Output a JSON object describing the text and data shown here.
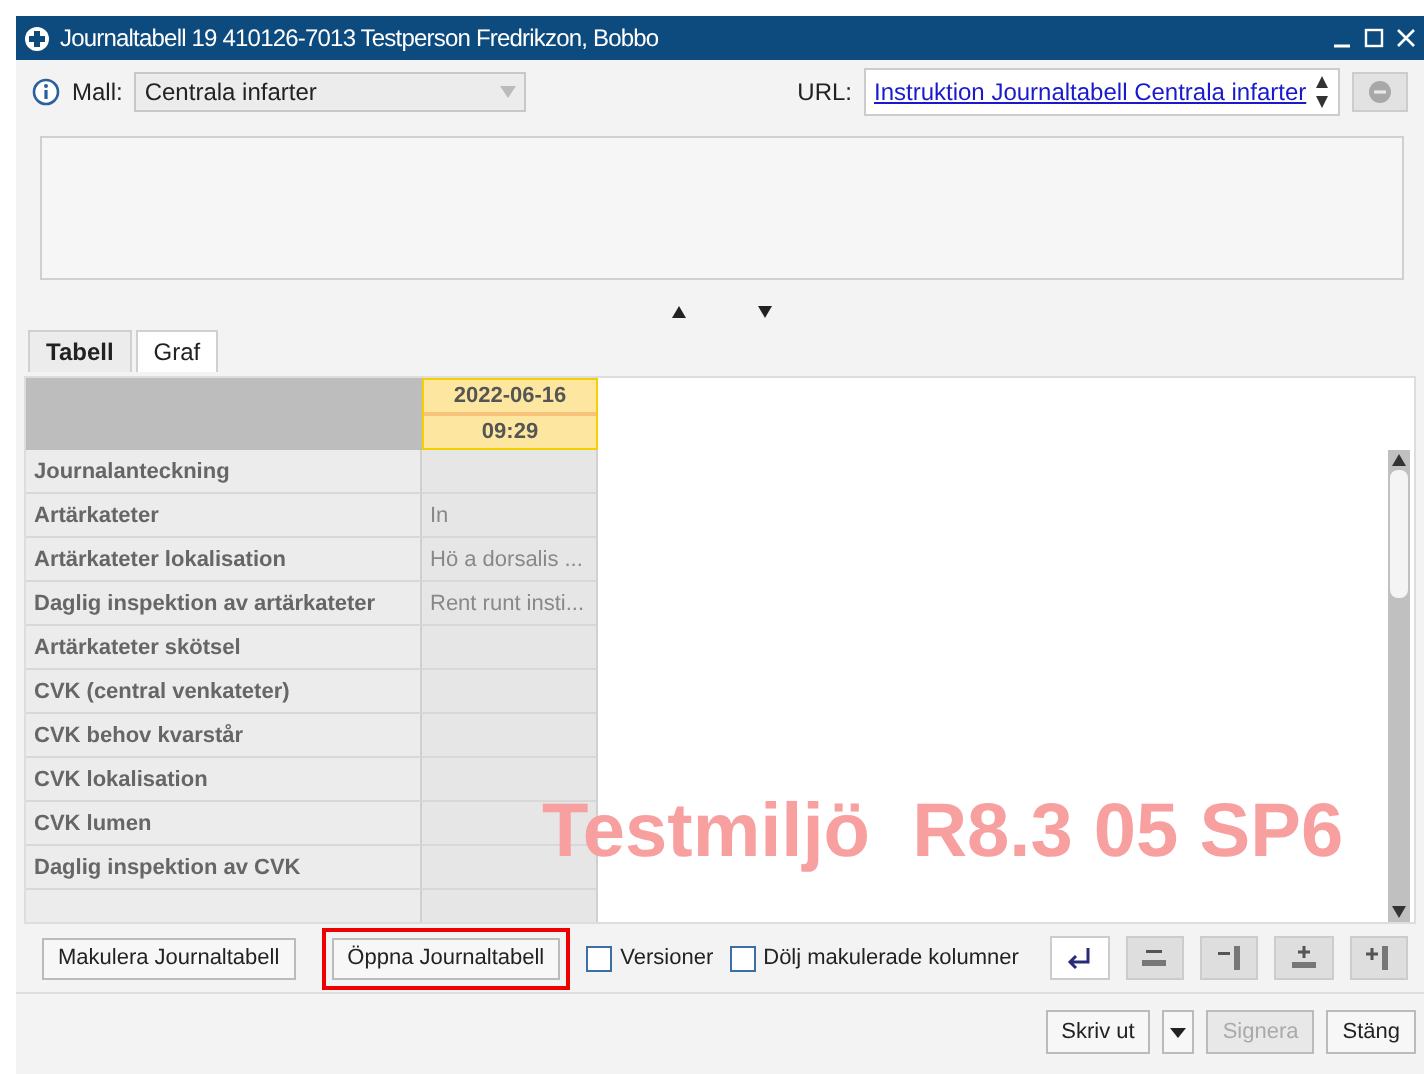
{
  "window": {
    "title": "Journaltabell 19 410126-7013 Testperson Fredrikzon, Bobbo"
  },
  "template": {
    "label": "Mall:",
    "value": "Centrala infarter"
  },
  "url": {
    "label": "URL:",
    "link": "Instruktion Journaltabell Centrala infarter"
  },
  "tabs": [
    {
      "label": "Tabell",
      "selected": true
    },
    {
      "label": "Graf",
      "selected": false
    }
  ],
  "table": {
    "columns": [
      {
        "date": "2022-06-16",
        "time": "09:29",
        "selected": true
      }
    ],
    "rows": [
      {
        "label": "Journalanteckning",
        "value": ""
      },
      {
        "label": "Artärkateter",
        "value": "In"
      },
      {
        "label": "Artärkateter lokalisation",
        "value": "Hö a dorsalis ..."
      },
      {
        "label": "Daglig inspektion av artärkateter",
        "value": "Rent runt insti..."
      },
      {
        "label": "Artärkateter skötsel",
        "value": ""
      },
      {
        "label": "CVK (central venkateter)",
        "value": ""
      },
      {
        "label": "CVK behov kvarstår",
        "value": ""
      },
      {
        "label": "CVK lokalisation",
        "value": ""
      },
      {
        "label": "CVK lumen",
        "value": ""
      },
      {
        "label": "Daglig inspektion av CVK",
        "value": ""
      }
    ]
  },
  "environment_banner": "Testmiljö  R8.3 05 SP6",
  "actions": [
    {
      "label": "Makulera Journaltabell",
      "highlighted": false
    },
    {
      "label": "Öppna Journaltabell",
      "highlighted": true
    }
  ],
  "checkboxes": [
    {
      "label": "Versioner",
      "checked": false
    },
    {
      "label": "Dölj makulerade kolumner",
      "checked": false
    }
  ],
  "footer_buttons": [
    {
      "label": "Skriv ut",
      "disabled": false,
      "kind": "split"
    },
    {
      "label": "Signera",
      "disabled": true,
      "kind": "plain"
    },
    {
      "label": "Stäng",
      "disabled": false,
      "kind": "plain"
    }
  ]
}
